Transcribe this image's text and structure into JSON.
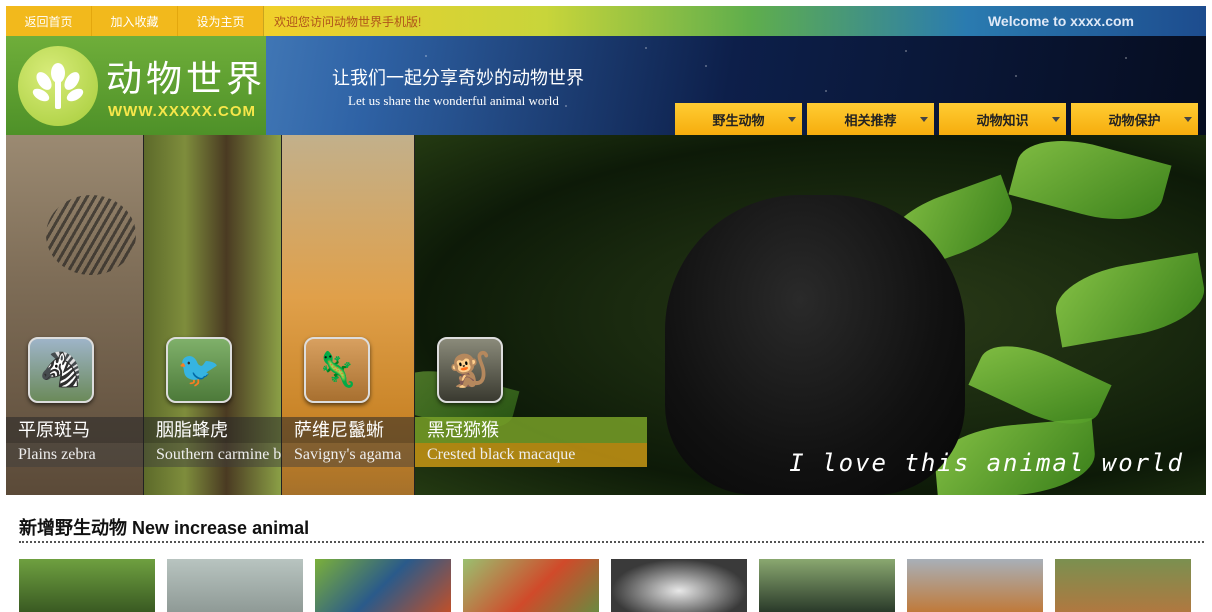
{
  "topbar": {
    "links": [
      "返回首页",
      "加入收藏",
      "设为主页"
    ],
    "welcome_cn": "欢迎您访问动物世界手机版!",
    "welcome_en": "Welcome to xxxx.com"
  },
  "header": {
    "logo_title": "动物世界",
    "logo_url": "WWW.XXXXX.COM",
    "slogan_cn": "让我们一起分享奇妙的动物世界",
    "slogan_en": "Let us share the wonderful animal world"
  },
  "nav": {
    "items": [
      "野生动物",
      "相关推荐",
      "动物知识",
      "动物保护"
    ]
  },
  "banner": {
    "slides": [
      {
        "name_cn": "平原斑马",
        "name_en": "Plains zebra",
        "icon": "zebra-icon"
      },
      {
        "name_cn": "胭脂蜂虎",
        "name_en": "Southern carmine bee-eater",
        "icon": "bird-icon"
      },
      {
        "name_cn": "萨维尼鬣蜥",
        "name_en": "Savigny's agama",
        "icon": "lizard-icon"
      },
      {
        "name_cn": "黑冠猕猴",
        "name_en": "Crested black macaque",
        "icon": "monkey-icon",
        "active": true
      }
    ],
    "script_text": "I love this animal world"
  },
  "new_section": {
    "title": "新增野生动物 New increase animal",
    "cards": [
      {
        "icon": "buffalo-icon"
      },
      {
        "icon": "grey-icon"
      },
      {
        "icon": "kingfisher-icon"
      },
      {
        "icon": "kingfisher-red-icon"
      },
      {
        "icon": "owl-icon"
      },
      {
        "icon": "bird-dark-icon"
      },
      {
        "icon": "lemur-icon"
      },
      {
        "icon": "deer-icon"
      }
    ]
  },
  "colors": {
    "nav_bg": "#f6ad0d",
    "logo_green": "#5a9c2e",
    "active_cap_green": "#78a028",
    "active_cap_gold": "#c89614"
  }
}
